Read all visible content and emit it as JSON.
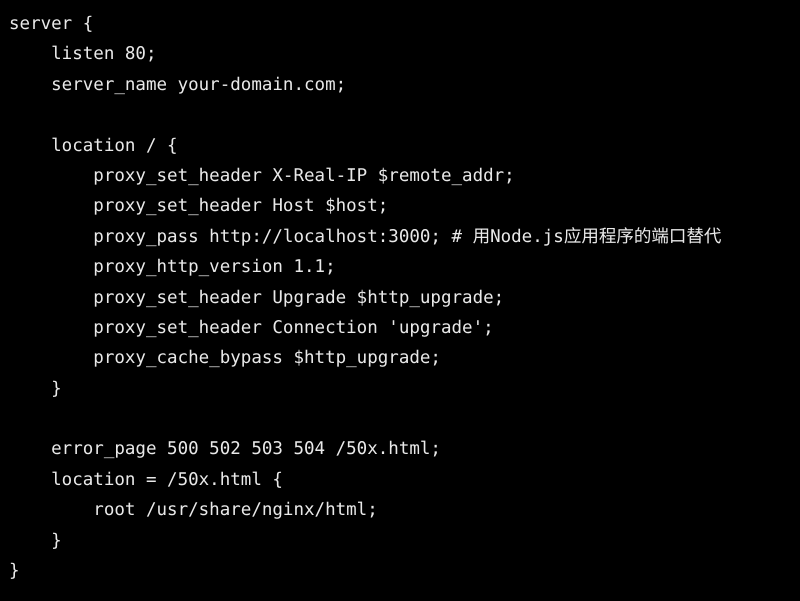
{
  "editor": {
    "background_color": "#000000",
    "text_color": "#e9e9e9",
    "language": "nginx",
    "font_size_px": 17.5,
    "line_height_px": 30.4,
    "indent_spaces": 4
  },
  "code": {
    "lines": [
      "server {",
      "    listen 80;",
      "    server_name your-domain.com;",
      "",
      "    location / {",
      "        proxy_set_header X-Real-IP $remote_addr;",
      "        proxy_set_header Host $host;",
      "        proxy_pass http://localhost:3000; # 用Node.js应用程序的端口替代",
      "        proxy_http_version 1.1;",
      "        proxy_set_header Upgrade $http_upgrade;",
      "        proxy_set_header Connection 'upgrade';",
      "        proxy_cache_bypass $http_upgrade;",
      "    }",
      "",
      "    error_page 500 502 503 504 /50x.html;",
      "    location = /50x.html {",
      "        root /usr/share/nginx/html;",
      "    }",
      "}"
    ]
  }
}
